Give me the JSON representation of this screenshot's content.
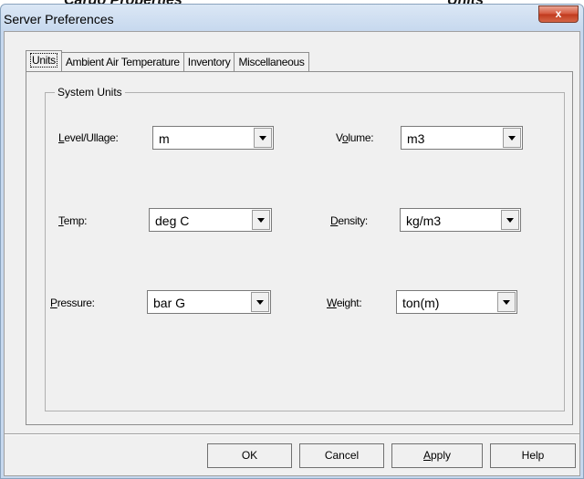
{
  "top_strip": {
    "left_text": "Cargo Properties",
    "right_text": "Units"
  },
  "window": {
    "title": "Server Preferences",
    "close_label": "x"
  },
  "tabs": [
    {
      "label": "Units"
    },
    {
      "label": "Ambient Air Temperature"
    },
    {
      "label": "Inventory"
    },
    {
      "label": "Miscellaneous"
    }
  ],
  "groupbox": {
    "label": "System Units"
  },
  "fields": {
    "level_ullage": {
      "accel": "L",
      "rest": "evel/Ullage:",
      "value": "m"
    },
    "volume": {
      "pre": "V",
      "accel": "o",
      "rest": "lume:",
      "value": "m3"
    },
    "temp": {
      "accel": "T",
      "rest": "emp:",
      "value": "deg C"
    },
    "density": {
      "accel": "D",
      "rest": "ensity:",
      "value": "kg/m3"
    },
    "pressure": {
      "accel": "P",
      "rest": "ressure:",
      "value": "bar G"
    },
    "weight": {
      "accel": "W",
      "rest": "eight:",
      "value": "ton(m)"
    }
  },
  "buttons": {
    "ok": "OK",
    "cancel": "Cancel",
    "apply_accel": "A",
    "apply_rest": "pply",
    "help": "Help"
  }
}
